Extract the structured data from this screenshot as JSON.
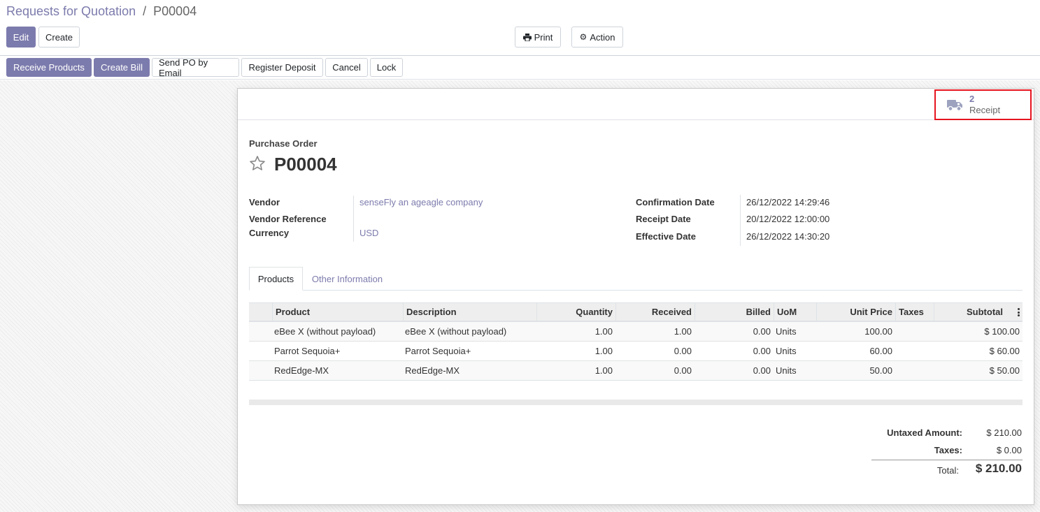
{
  "breadcrumb": {
    "parent": "Requests for Quotation",
    "separator": "/",
    "current": "P00004"
  },
  "toolbar": {
    "edit": "Edit",
    "create": "Create",
    "print": "Print",
    "action": "Action"
  },
  "statusbar": {
    "receive_products": "Receive Products",
    "create_bill": "Create Bill",
    "send_po": "Send PO by Email",
    "register_deposit": "Register Deposit",
    "cancel": "Cancel",
    "lock": "Lock"
  },
  "smart_button": {
    "value": "2",
    "label": "Receipt",
    "icon": "truck-icon"
  },
  "form": {
    "doc_type": "Purchase Order",
    "name": "P00004",
    "left_fields": [
      {
        "label": "Vendor",
        "value": "senseFly an ageagle company"
      },
      {
        "label": "Vendor Reference",
        "value": ""
      },
      {
        "label": "Currency",
        "value": "USD"
      }
    ],
    "right_fields": [
      {
        "label": "Confirmation Date",
        "value": "26/12/2022 14:29:46"
      },
      {
        "label": "Receipt Date",
        "value": "20/12/2022 12:00:00"
      },
      {
        "label": "Effective Date",
        "value": "26/12/2022 14:30:20"
      }
    ]
  },
  "tabs": [
    {
      "label": "Products"
    },
    {
      "label": "Other Information"
    }
  ],
  "table": {
    "columns": [
      "Product",
      "Description",
      "Quantity",
      "Received",
      "Billed",
      "UoM",
      "Unit Price",
      "Taxes",
      "Subtotal"
    ],
    "rows": [
      {
        "product": "eBee X (without payload)",
        "description": "eBee X (without payload)",
        "quantity": "1.00",
        "received": "1.00",
        "billed": "0.00",
        "uom": "Units",
        "unit_price": "100.00",
        "taxes": "",
        "subtotal": "$ 100.00"
      },
      {
        "product": "Parrot Sequoia+",
        "description": "Parrot Sequoia+",
        "quantity": "1.00",
        "received": "0.00",
        "billed": "0.00",
        "uom": "Units",
        "unit_price": "60.00",
        "taxes": "",
        "subtotal": "$ 60.00"
      },
      {
        "product": "RedEdge-MX",
        "description": "RedEdge-MX",
        "quantity": "1.00",
        "received": "0.00",
        "billed": "0.00",
        "uom": "Units",
        "unit_price": "50.00",
        "taxes": "",
        "subtotal": "$ 50.00"
      }
    ]
  },
  "totals": {
    "untaxed_label": "Untaxed Amount:",
    "untaxed_value": "$ 210.00",
    "taxes_label": "Taxes:",
    "taxes_value": "$ 0.00",
    "total_label": "Total:",
    "total_value": "$ 210.00"
  },
  "colors": {
    "brand": "#7c7bad",
    "highlight": "#e6141f"
  }
}
